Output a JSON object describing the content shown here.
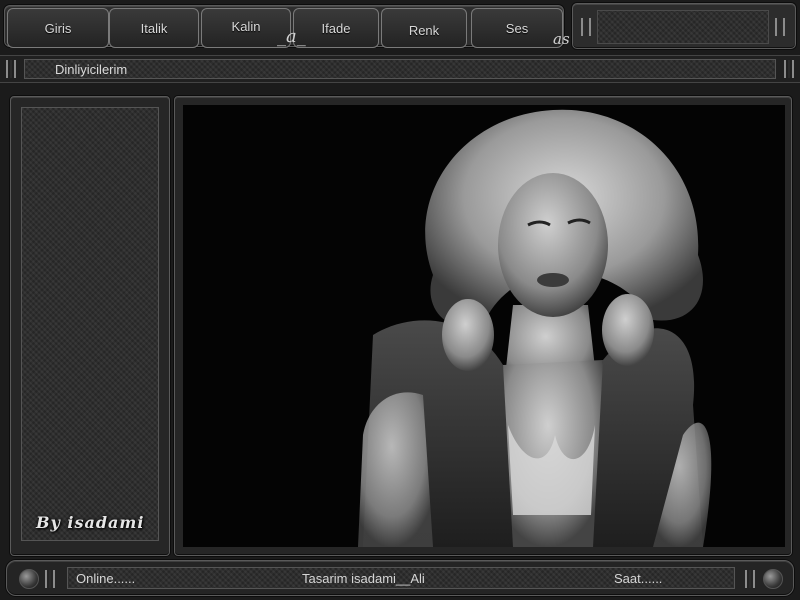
{
  "toolbar": {
    "tabs": [
      "Giris",
      "Italik",
      "Kalin",
      "Ifade",
      "Renk",
      "Ses"
    ],
    "logo_mark": "_a_",
    "logo_mark2": "as"
  },
  "titlebar": {
    "title": "Dinliyicilerim"
  },
  "left_panel": {
    "signature": "By isadami"
  },
  "status": {
    "online": "Online......",
    "credit": "Tasarim  isadami__Ali",
    "clock": "Saat......"
  },
  "colors": {
    "background": "#1b1b1b",
    "panel": "#2a2a2a",
    "border": "#7a7a7a",
    "text": "#d8d8d8"
  }
}
